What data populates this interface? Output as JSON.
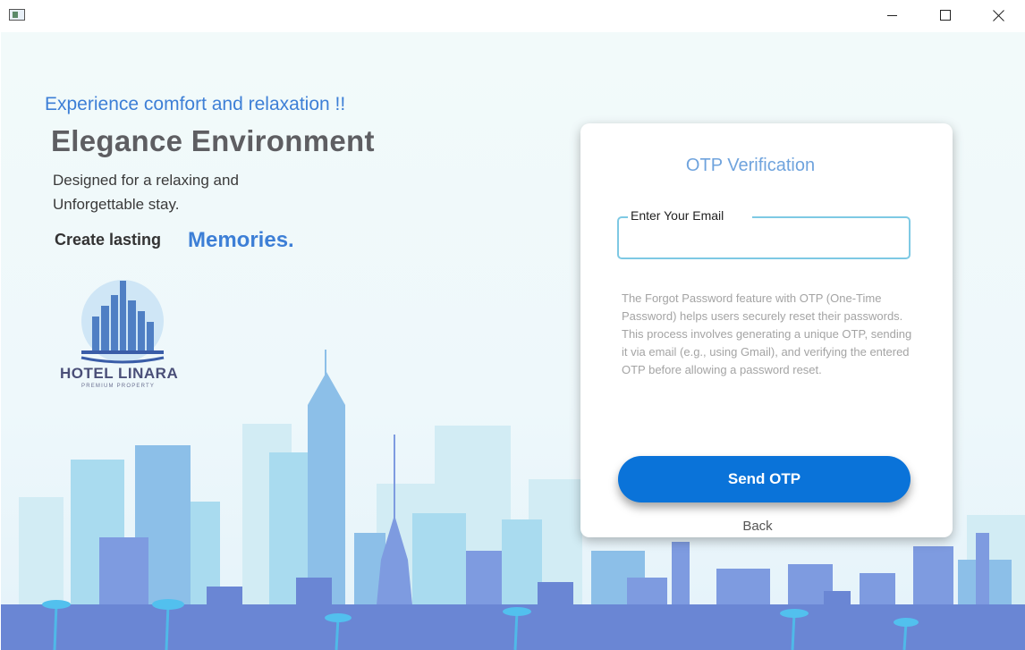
{
  "window": {
    "icons": {
      "app": "app-window-icon",
      "minimize": "minimize-icon",
      "maximize": "maximize-icon",
      "close": "close-icon"
    }
  },
  "hero": {
    "tagline": "Experience comfort and relaxation !!",
    "headline": "Elegance Environment",
    "description_line1": "Designed for a relaxing and",
    "description_line2": "Unforgettable stay.",
    "cta_prefix": "Create lasting",
    "cta_emphasis": "Memories."
  },
  "logo": {
    "name": "HOTEL LINARA",
    "subtitle": "PREMIUM PROPERTY"
  },
  "otp_card": {
    "title": "OTP Verification",
    "email_label": "Enter Your Email",
    "email_value": "",
    "info_text": "The Forgot Password feature with OTP (One-Time Password) helps users securely reset their passwords. This process involves generating a unique OTP, sending it via email (e.g., using Gmail), and verifying the entered OTP before allowing a password reset.",
    "send_button": "Send OTP",
    "back_link": "Back"
  },
  "colors": {
    "accent_blue": "#3d7fd6",
    "button_blue": "#0a73d9",
    "field_border": "#7ec9e4",
    "headline_gray": "#5e5e62"
  }
}
